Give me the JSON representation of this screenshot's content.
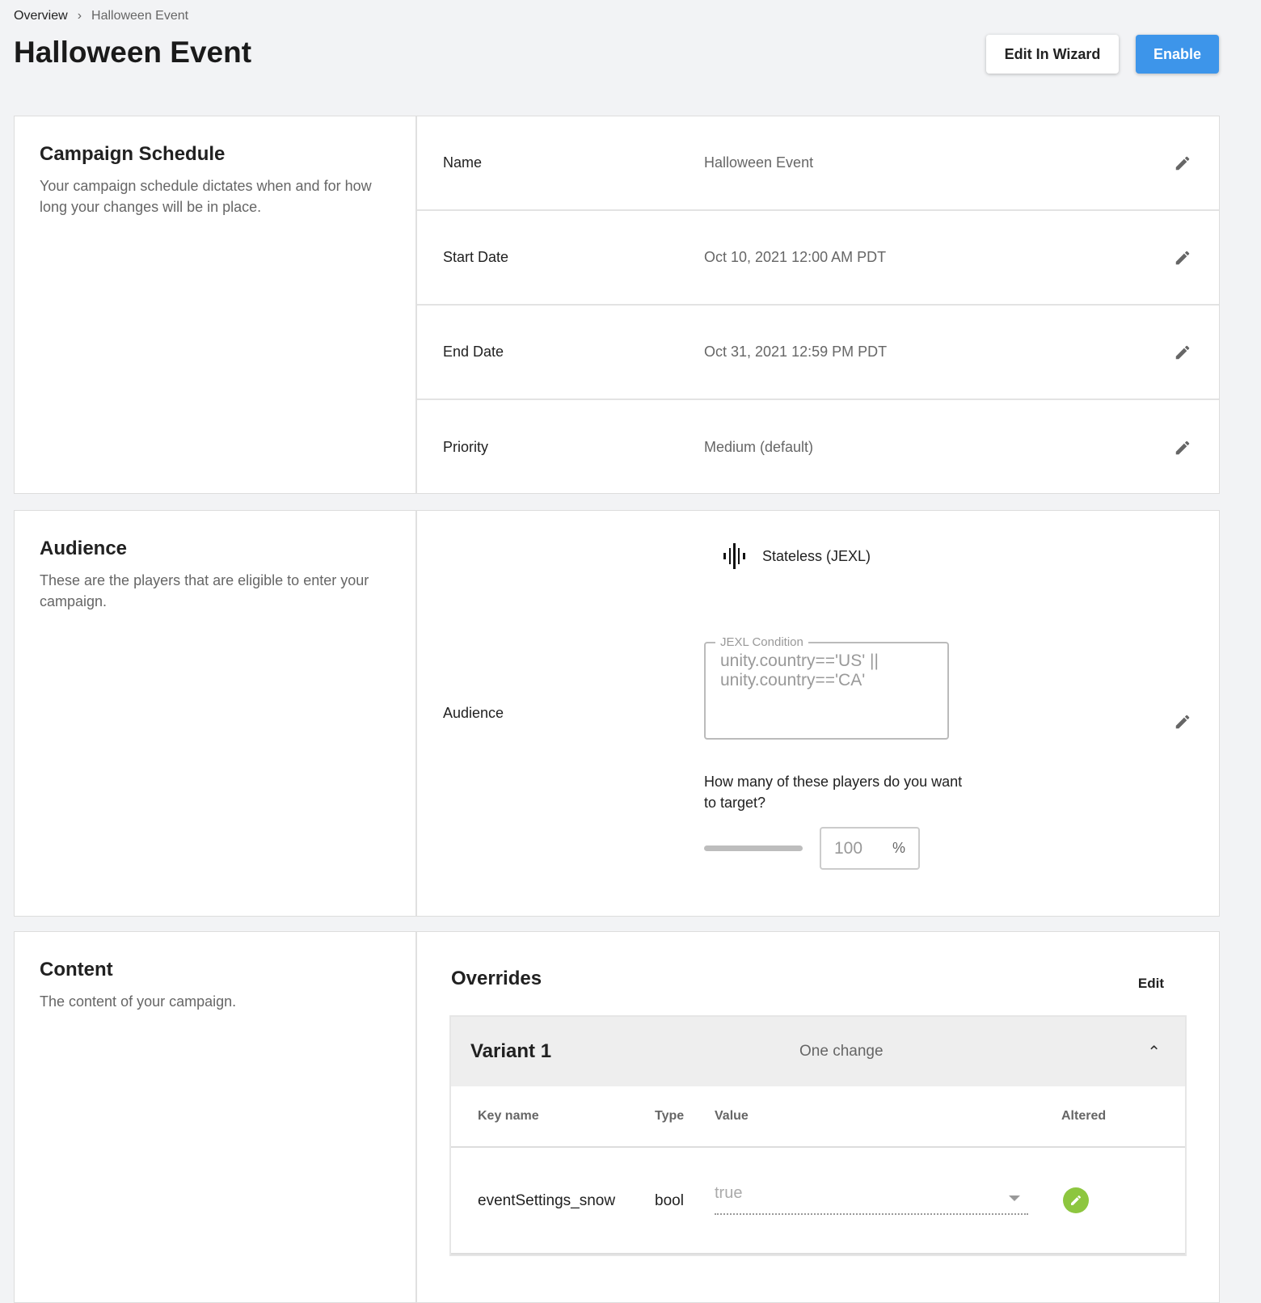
{
  "breadcrumb": {
    "items": [
      "Overview",
      "Halloween Event"
    ]
  },
  "page_title": "Halloween Event",
  "actions": {
    "edit_wizard": "Edit In Wizard",
    "enable": "Enable"
  },
  "colors": {
    "accent": "#3d95ea",
    "altered": "#8dc63f"
  },
  "schedule": {
    "title": "Campaign Schedule",
    "description": "Your campaign schedule dictates when and for how long your changes will be in place.",
    "rows": [
      {
        "label": "Name",
        "value": "Halloween Event"
      },
      {
        "label": "Start Date",
        "value": "Oct 10, 2021 12:00 AM PDT"
      },
      {
        "label": "End Date",
        "value": "Oct 31, 2021 12:59 PM PDT"
      },
      {
        "label": "Priority",
        "value": "Medium (default)"
      }
    ]
  },
  "audience": {
    "title": "Audience",
    "description": "These are the players that are eligible to enter your campaign.",
    "label": "Audience",
    "type": "Stateless (JEXL)",
    "jexl_label": "JEXL Condition",
    "jexl_value": "unity.country=='US' || unity.country=='CA'",
    "question": "How many of these players do you want to target?",
    "percent": "100",
    "percent_sign": "%",
    "slider_fraction": 1.0
  },
  "content": {
    "title": "Content",
    "description": "The content of your campaign.",
    "overrides": "Overrides",
    "edit": "Edit",
    "variant": {
      "name": "Variant 1",
      "changes": "One change",
      "columns": [
        "Key name",
        "Type",
        "Value",
        "Altered"
      ],
      "rows": [
        {
          "key": "eventSettings_snow",
          "type": "bool",
          "value": "true"
        }
      ]
    }
  }
}
